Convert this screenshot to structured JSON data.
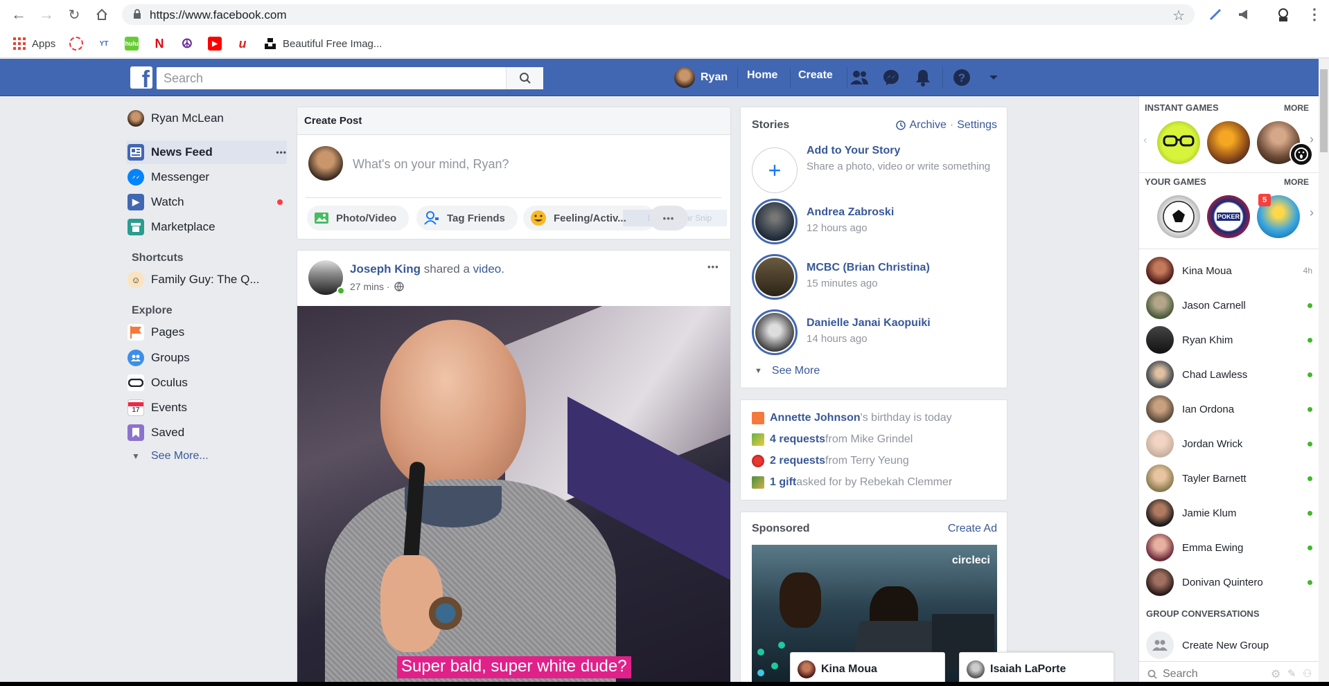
{
  "browser": {
    "url": "https://www.facebook.com",
    "bookmarks": [
      {
        "label": "Apps",
        "icon": "apps-grid-icon"
      },
      {
        "label": "",
        "icon": "opera-icon"
      },
      {
        "label": "",
        "icon": "ytmp3-icon"
      },
      {
        "label": "",
        "icon": "hulu-icon"
      },
      {
        "label": "",
        "icon": "netflix-icon"
      },
      {
        "label": "",
        "icon": "peace-icon"
      },
      {
        "label": "",
        "icon": "youtube-icon"
      },
      {
        "label": "",
        "icon": "u-icon"
      },
      {
        "label": "Beautiful Free Imag...",
        "icon": "unsplash-icon"
      }
    ]
  },
  "fb_header": {
    "search_placeholder": "Search",
    "user_name": "Ryan",
    "home": "Home",
    "create": "Create"
  },
  "left_nav": {
    "profile": "Ryan McLean",
    "items": [
      {
        "label": "News Feed",
        "more": "•••"
      },
      {
        "label": "Messenger"
      },
      {
        "label": "Watch"
      },
      {
        "label": "Marketplace"
      }
    ],
    "shortcuts_heading": "Shortcuts",
    "shortcuts": [
      "Family Guy: The Q..."
    ],
    "explore_heading": "Explore",
    "explore": [
      "Pages",
      "Groups",
      "Oculus",
      "Events",
      "Saved"
    ],
    "see_more": "See More..."
  },
  "create_post": {
    "title": "Create Post",
    "placeholder": "What's on your mind, Ryan?",
    "actions": [
      "Photo/Video",
      "Tag Friends",
      "Feeling/Activ..."
    ],
    "more": "•••",
    "ghost_text": "Rectangular Snip"
  },
  "post": {
    "author": "Joseph King",
    "action": " shared a ",
    "object": "video.",
    "time": "27 mins ·",
    "more": "•••",
    "caption": "Super bald, super white dude?"
  },
  "stories": {
    "title": "Stories",
    "archive": "Archive",
    "separator": "·",
    "settings": "Settings",
    "add_title": "Add to Your Story",
    "add_sub": "Share a photo, video or write something",
    "items": [
      {
        "name": "Andrea Zabroski",
        "time": "12 hours ago"
      },
      {
        "name": "MCBC (Brian Christina)",
        "time": "15 minutes ago"
      },
      {
        "name": "Danielle Janai Kaopuiki",
        "time": "14 hours ago"
      }
    ],
    "see_more": "See More"
  },
  "notices": [
    {
      "bold": "Annette Johnson",
      "rest": "'s birthday is today"
    },
    {
      "bold": "4 requests",
      "rest": " from Mike Grindel"
    },
    {
      "bold": "2 requests",
      "rest": " from Terry Yeung"
    },
    {
      "bold": "1 gift",
      "rest": " asked for by Rebekah Clemmer"
    }
  ],
  "sponsored": {
    "title": "Sponsored",
    "create_ad": "Create Ad",
    "brand": "circleci"
  },
  "chat_sidebar": {
    "instant_games": "INSTANT GAMES",
    "your_games": "YOUR GAMES",
    "more": "MORE",
    "game_badge": "5",
    "contacts": [
      {
        "name": "Kina Moua",
        "status": "4h"
      },
      {
        "name": "Jason Carnell",
        "status": "online"
      },
      {
        "name": "Ryan Khim",
        "status": "online"
      },
      {
        "name": "Chad Lawless",
        "status": "online"
      },
      {
        "name": "Ian Ordona",
        "status": "online"
      },
      {
        "name": "Jordan Wrick",
        "status": "online"
      },
      {
        "name": "Tayler Barnett",
        "status": "online"
      },
      {
        "name": "Jamie Klum",
        "status": "online"
      },
      {
        "name": "Emma Ewing",
        "status": "online"
      },
      {
        "name": "Donivan Quintero",
        "status": "online"
      }
    ],
    "group_conversations": "GROUP CONVERSATIONS",
    "create_group": "Create New Group",
    "search_placeholder": "Search"
  },
  "chat_tabs": [
    "Kina Moua",
    "Isaiah LaPorte"
  ],
  "colors": {
    "fb_blue": "#4267b2",
    "link": "#385898",
    "online": "#42b72a",
    "notif_red": "#fa3e3e"
  }
}
